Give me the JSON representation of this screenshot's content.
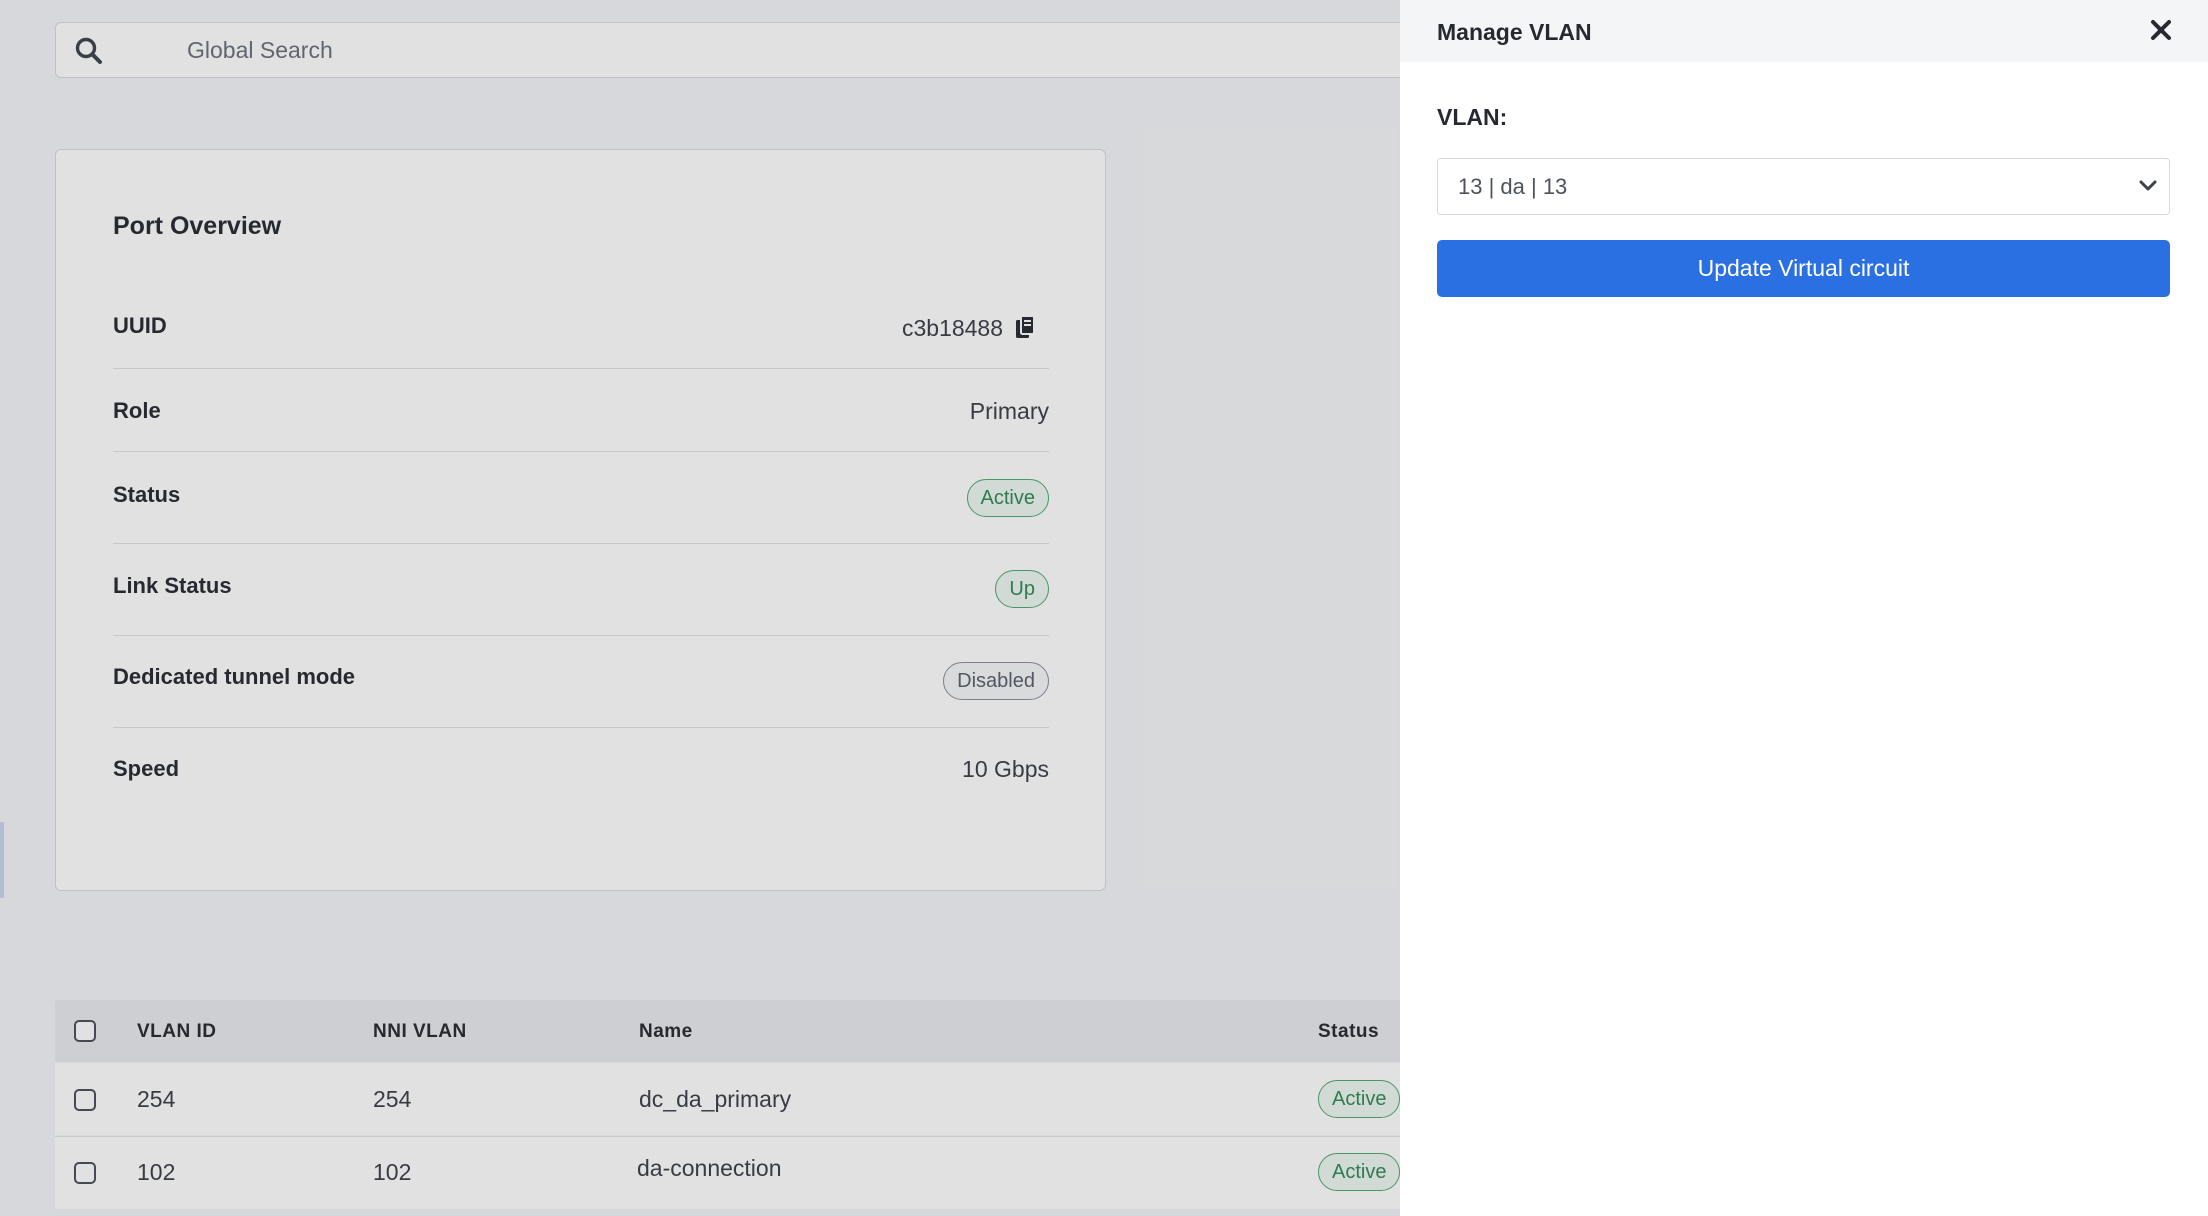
{
  "search": {
    "placeholder": "Global Search"
  },
  "port_overview": {
    "title": "Port Overview",
    "rows": [
      {
        "label": "UUID",
        "value": "c3b18488"
      },
      {
        "label": "Role",
        "value": "Primary"
      },
      {
        "label": "Status",
        "value": "Active"
      },
      {
        "label": "Link Status",
        "value": "Up"
      },
      {
        "label": "Dedicated tunnel mode",
        "value": "Disabled"
      },
      {
        "label": "Speed",
        "value": "10 Gbps"
      }
    ]
  },
  "vlan_table": {
    "columns": [
      "VLAN ID",
      "NNI VLAN",
      "Name",
      "Status"
    ],
    "rows": [
      {
        "vlan_id": "254",
        "nni_vlan": "254",
        "name": "dc_da_primary",
        "status": "Active"
      },
      {
        "vlan_id": "102",
        "nni_vlan": "102",
        "name": "da-connection",
        "status": "Active"
      }
    ]
  },
  "drawer": {
    "title": "Manage VLAN",
    "vlan_label": "VLAN:",
    "vlan_selected": "13 | da | 13",
    "update_button_label": "Update Virtual circuit"
  },
  "icons": {
    "search": "search-icon",
    "copy": "copy-icon",
    "close": "close-icon",
    "dropdown": "chevron-down-icon"
  },
  "colors": {
    "primary": "#2b70e3",
    "success": "#2f8a55",
    "neutral": "#59606a"
  }
}
